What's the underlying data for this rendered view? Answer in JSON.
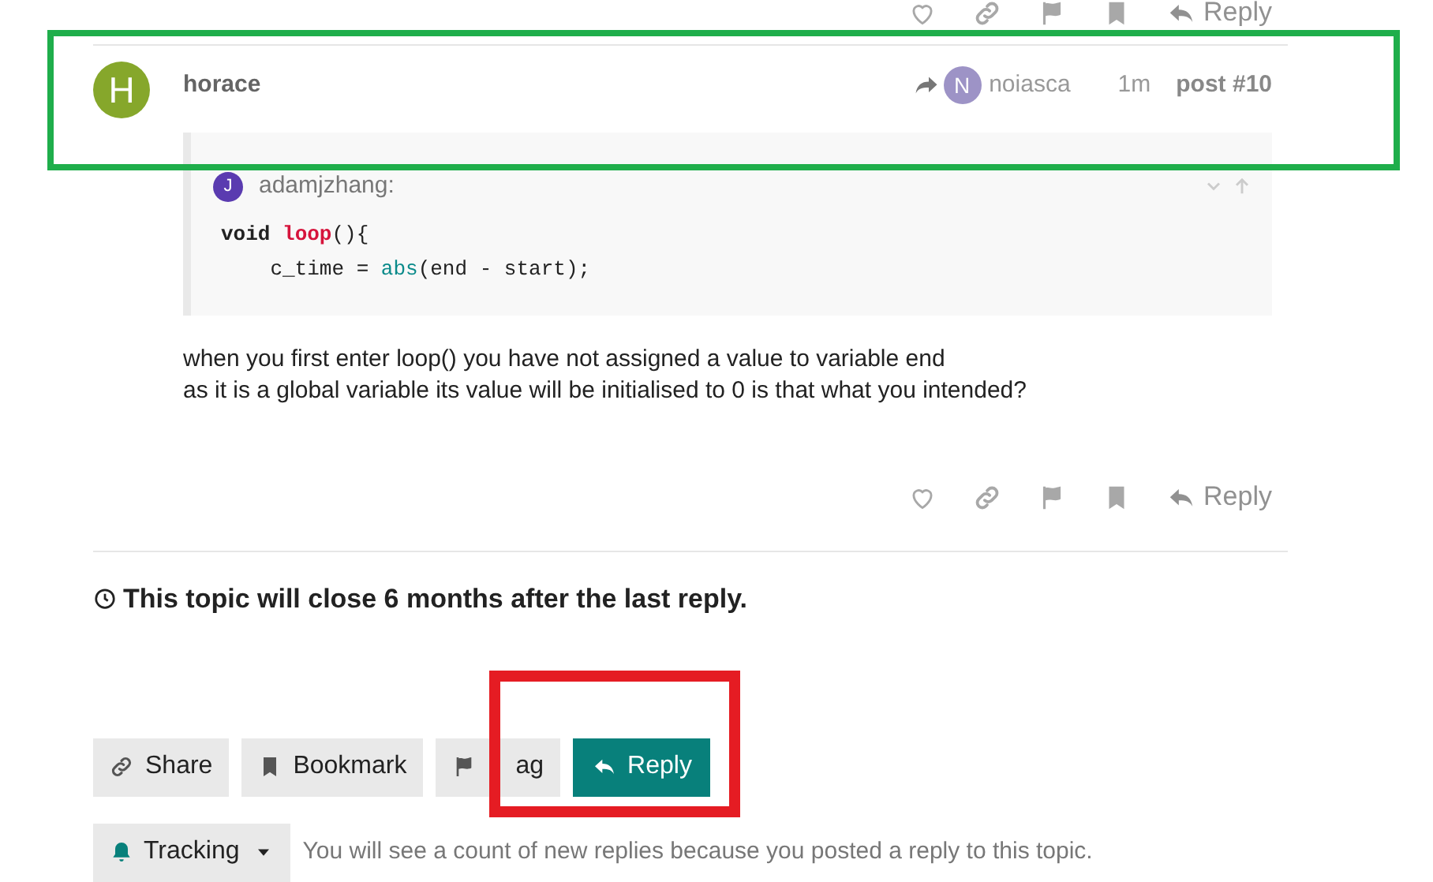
{
  "previous_post_actions": {
    "reply_label": "Reply"
  },
  "post": {
    "author": "horace",
    "avatar_letter": "H",
    "reply_to": {
      "name": "noiasca",
      "avatar_letter": "N"
    },
    "age": "1m",
    "number": "post #10",
    "quote": {
      "author": "adamjzhang:",
      "avatar_letter": "J",
      "code": [
        [
          "void ",
          "loop",
          "(){"
        ],
        [
          "    c_time = ",
          "abs",
          "(end - start);"
        ]
      ]
    },
    "body": [
      "when you first enter loop() you have not assigned a value to variable end",
      "as it is a global variable its value will be initialised to 0 is that what you intended?"
    ],
    "reply_label": "Reply"
  },
  "closing_notice": "This topic will close 6 months after the last reply.",
  "footer_buttons": [
    {
      "kind": "share",
      "label": "Share",
      "primary": false
    },
    {
      "kind": "bookmark",
      "label": "Bookmark",
      "primary": false
    },
    {
      "kind": "flag",
      "label": "ag",
      "primary": false
    },
    {
      "kind": "reply",
      "label": "Reply",
      "primary": true
    }
  ],
  "notification": {
    "level": "Tracking",
    "description": "You will see a count of new replies because you posted a reply to this topic."
  },
  "annotations": [
    {
      "color": "#1fae4b"
    },
    {
      "color": "#e51c23"
    }
  ]
}
